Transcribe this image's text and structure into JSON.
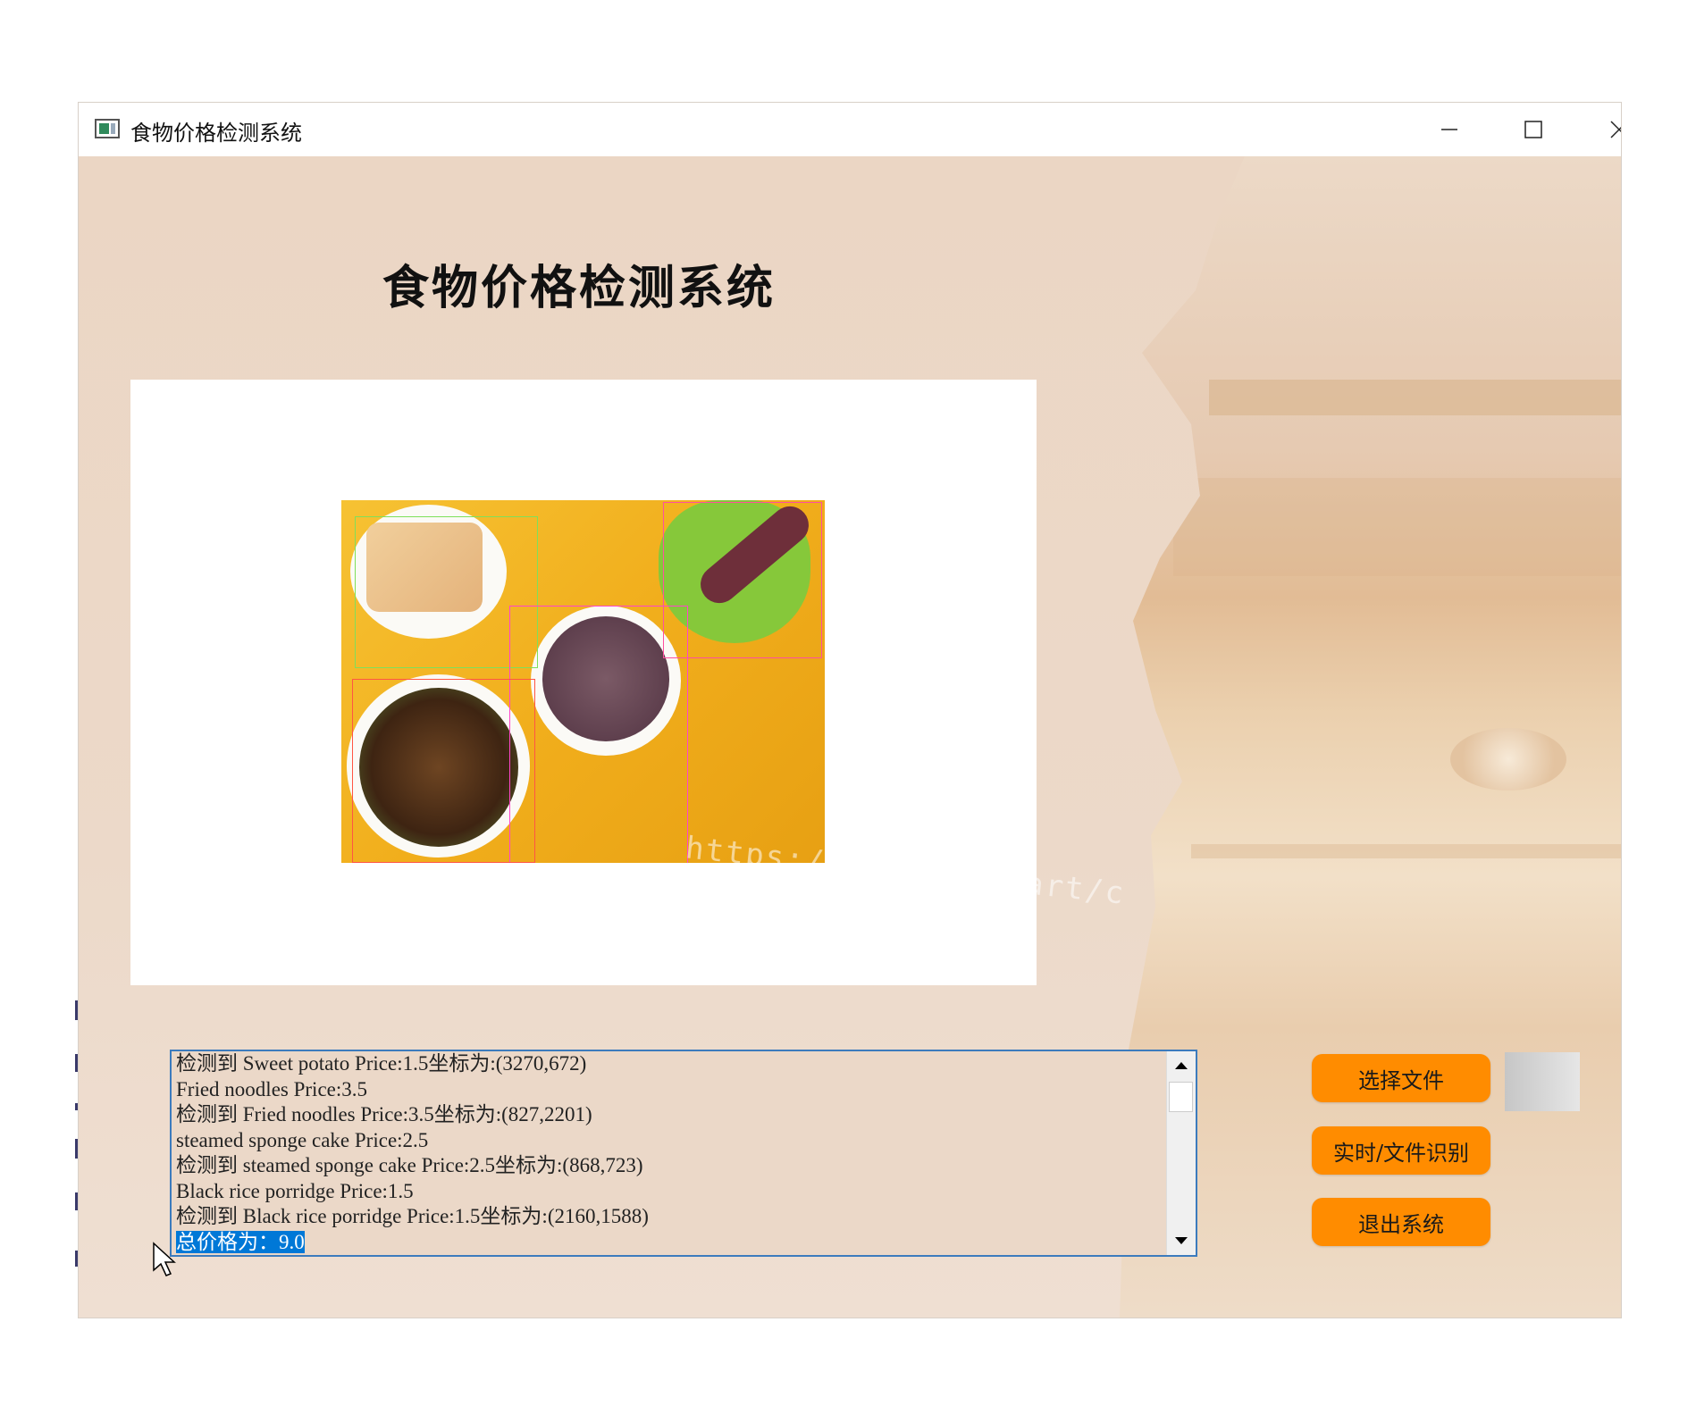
{
  "window": {
    "title": "食物价格检测系统",
    "controls": [
      "minimize-icon",
      "maximize-icon",
      "close-icon"
    ]
  },
  "header": {
    "title": "食物价格检测系统"
  },
  "image_panel": {
    "watermark": "https://mbd.6pen.art/c  "
  },
  "log": {
    "lines": [
      "检测到 Sweet potato Price:1.5坐标为:(3270,672)",
      "Fried noodles Price:3.5",
      "检测到 Fried noodles Price:3.5坐标为:(827,2201)",
      "steamed sponge cake Price:2.5",
      "检测到 steamed sponge cake Price:2.5坐标为:(868,723)",
      "Black rice porridge Price:1.5",
      "检测到 Black rice porridge Price:1.5坐标为:(2160,1588)"
    ],
    "selected_line": "总价格为：9.0"
  },
  "buttons": {
    "select_file": "选择文件",
    "realtime": "实时/文件识别",
    "exit": "退出系统"
  },
  "colors": {
    "accent_button": "#ff8c00",
    "background": "#ebd8c8",
    "selection": "#0078d7"
  }
}
